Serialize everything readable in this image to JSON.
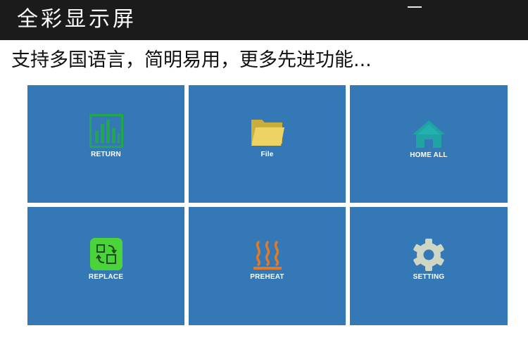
{
  "banner": {
    "title": "全彩显示屏"
  },
  "subtitle": "支持多国语言，简明易用，更多先进功能...",
  "colors": {
    "banner_bg": "#1b1b1b",
    "tile_bg": "#3578b6",
    "label": "#ffffff"
  },
  "tiles": [
    {
      "label": "RETURN",
      "icon": "bar-chart-icon"
    },
    {
      "label": "File",
      "icon": "folder-icon"
    },
    {
      "label": "HOME ALL",
      "icon": "home-icon"
    },
    {
      "label": "REPLACE",
      "icon": "swap-icon"
    },
    {
      "label": "PREHEAT",
      "icon": "heat-icon"
    },
    {
      "label": "SETTING",
      "icon": "gear-icon"
    }
  ]
}
